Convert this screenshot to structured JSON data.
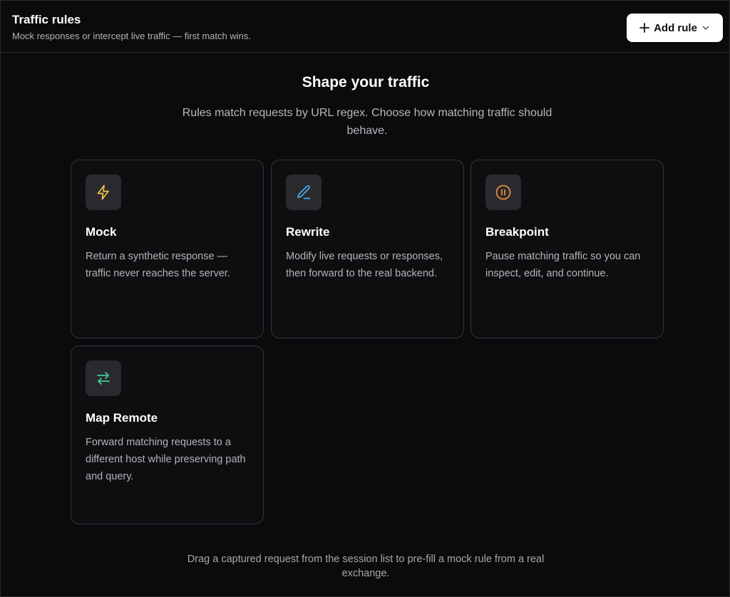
{
  "header": {
    "title": "Traffic rules",
    "subtitle": "Mock responses or intercept live traffic — first match wins.",
    "add_rule_label": "Add rule"
  },
  "hero": {
    "title": "Shape your traffic",
    "subtitle": "Rules match requests by URL regex. Choose how matching traffic should behave."
  },
  "cards": [
    {
      "title": "Mock",
      "description": "Return a synthetic response — traffic never reaches the server.",
      "icon": "lightning-icon",
      "icon_color": "#f5c243"
    },
    {
      "title": "Rewrite",
      "description": "Modify live requests or responses, then forward to the real backend.",
      "icon": "pencil-icon",
      "icon_color": "#4aa8e8"
    },
    {
      "title": "Breakpoint",
      "description": "Pause matching traffic so you can inspect, edit, and continue.",
      "icon": "pause-circle-icon",
      "icon_color": "#f0913a"
    },
    {
      "title": "Map Remote",
      "description": "Forward matching requests to a different host while preserving path and query.",
      "icon": "swap-arrows-icon",
      "icon_color": "#3ecf9a"
    }
  ],
  "footer": {
    "note": "Drag a captured request from the session list to pre-fill a mock rule from a real exchange."
  }
}
